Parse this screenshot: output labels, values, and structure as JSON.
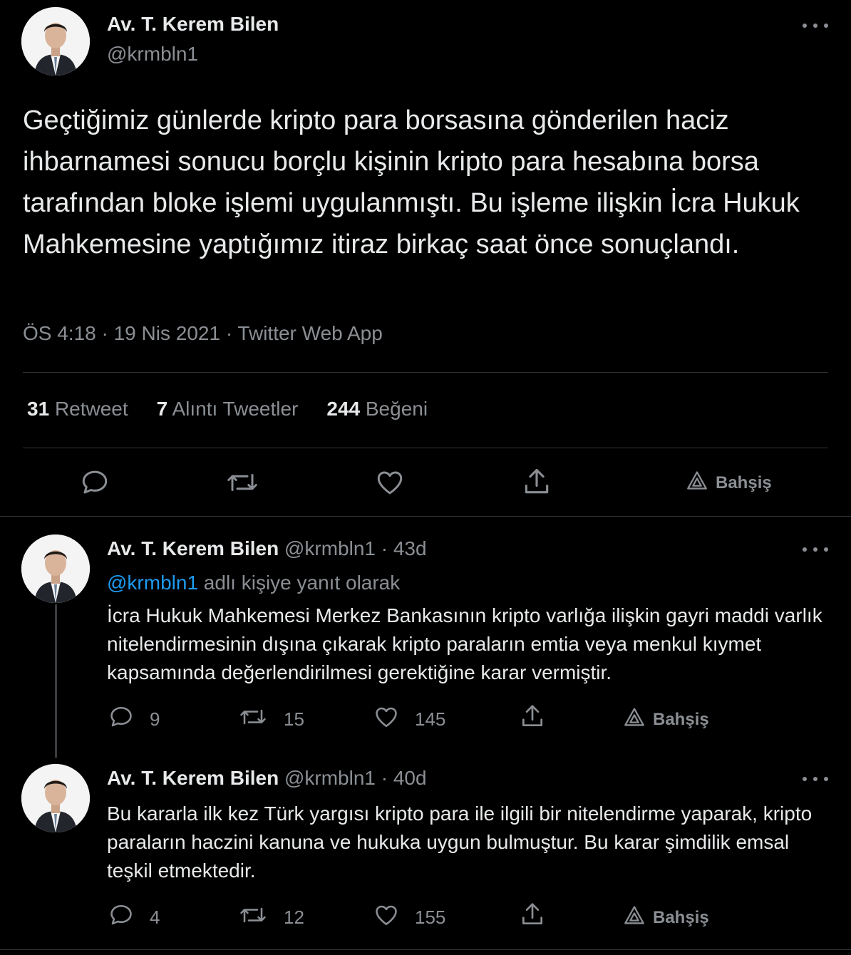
{
  "main_tweet": {
    "author_name": "Av. T. Kerem Bilen",
    "handle": "@krmbln1",
    "text": "Geçtiğimiz günlerde kripto para borsasına gönderilen haciz ihbarnamesi sonucu borçlu kişinin kripto para hesabına borsa tarafından bloke işlemi uygulanmıştı. Bu işleme ilişkin İcra Hukuk Mahkemesine yaptığımız itiraz birkaç saat önce sonuçlandı.",
    "meta": "ÖS 4:18 · 19 Nis 2021 · Twitter Web App",
    "stats": {
      "retweet_count": "31",
      "retweet_label": "Retweet",
      "quote_count": "7",
      "quote_label": "Alıntı Tweetler",
      "like_count": "244",
      "like_label": "Beğeni"
    },
    "tip_label": "Bahşiş"
  },
  "replies": [
    {
      "author_name": "Av. T. Kerem Bilen",
      "handle_time": "@krmbln1 · 43d",
      "reply_to_handle": "@krmbln1",
      "reply_to_suffix": "adlı kişiye yanıt olarak",
      "text": "İcra Hukuk Mahkemesi Merkez Bankasının kripto varlığa ilişkin gayri maddi varlık nitelendirmesinin dışına çıkarak kripto paraların emtia veya menkul kıymet kapsamında değerlendirilmesi gerektiğine karar vermiştir.",
      "replies": "9",
      "retweets": "15",
      "likes": "145",
      "tip_label": "Bahşiş"
    },
    {
      "author_name": "Av. T. Kerem Bilen",
      "handle_time": "@krmbln1 · 40d",
      "text": "Bu kararla ilk kez Türk yargısı kripto para ile ilgili bir nitelendirme yaparak, kripto paraların haczini kanuna ve hukuka uygun bulmuştur. Bu karar şimdilik emsal teşkil etmektedir.",
      "replies": "4",
      "retweets": "12",
      "likes": "155",
      "tip_label": "Bahşiş"
    }
  ],
  "colors": {
    "background": "#000000",
    "text_primary": "#e7e9ea",
    "text_secondary": "#8b8f94",
    "link": "#1d9bf0",
    "divider": "#2f3336"
  },
  "icons": [
    "more-icon",
    "reply-icon",
    "retweet-icon",
    "like-icon",
    "share-icon",
    "tip-icon"
  ]
}
